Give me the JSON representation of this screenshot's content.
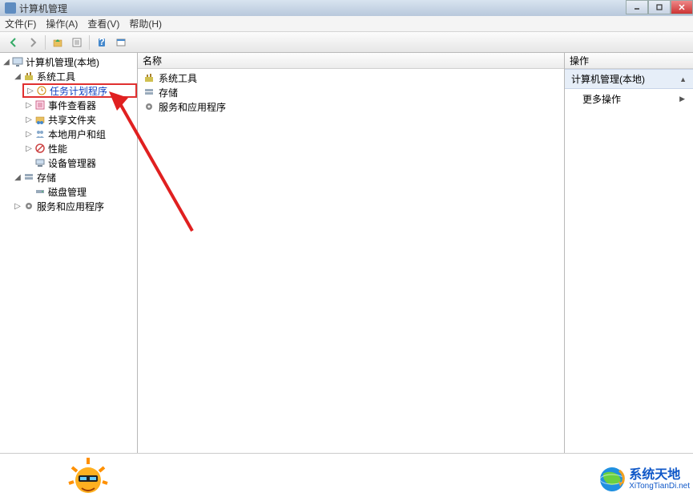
{
  "window": {
    "title": "计算机管理"
  },
  "menu": {
    "file": "文件(F)",
    "action": "操作(A)",
    "view": "查看(V)",
    "help": "帮助(H)"
  },
  "tree": {
    "root": "计算机管理(本地)",
    "system_tools": "系统工具",
    "task_scheduler": "任务计划程序",
    "event_viewer": "事件查看器",
    "shared_folders": "共享文件夹",
    "local_users": "本地用户和组",
    "performance": "性能",
    "device_manager": "设备管理器",
    "storage": "存储",
    "disk_mgmt": "磁盘管理",
    "services_apps": "服务和应用程序"
  },
  "list": {
    "header_name": "名称",
    "items": [
      "系统工具",
      "存储",
      "服务和应用程序"
    ]
  },
  "actions": {
    "header": "操作",
    "section": "计算机管理(本地)",
    "more": "更多操作"
  },
  "brand": {
    "name": "系统天地",
    "url": "XiTongTianDi.net"
  }
}
